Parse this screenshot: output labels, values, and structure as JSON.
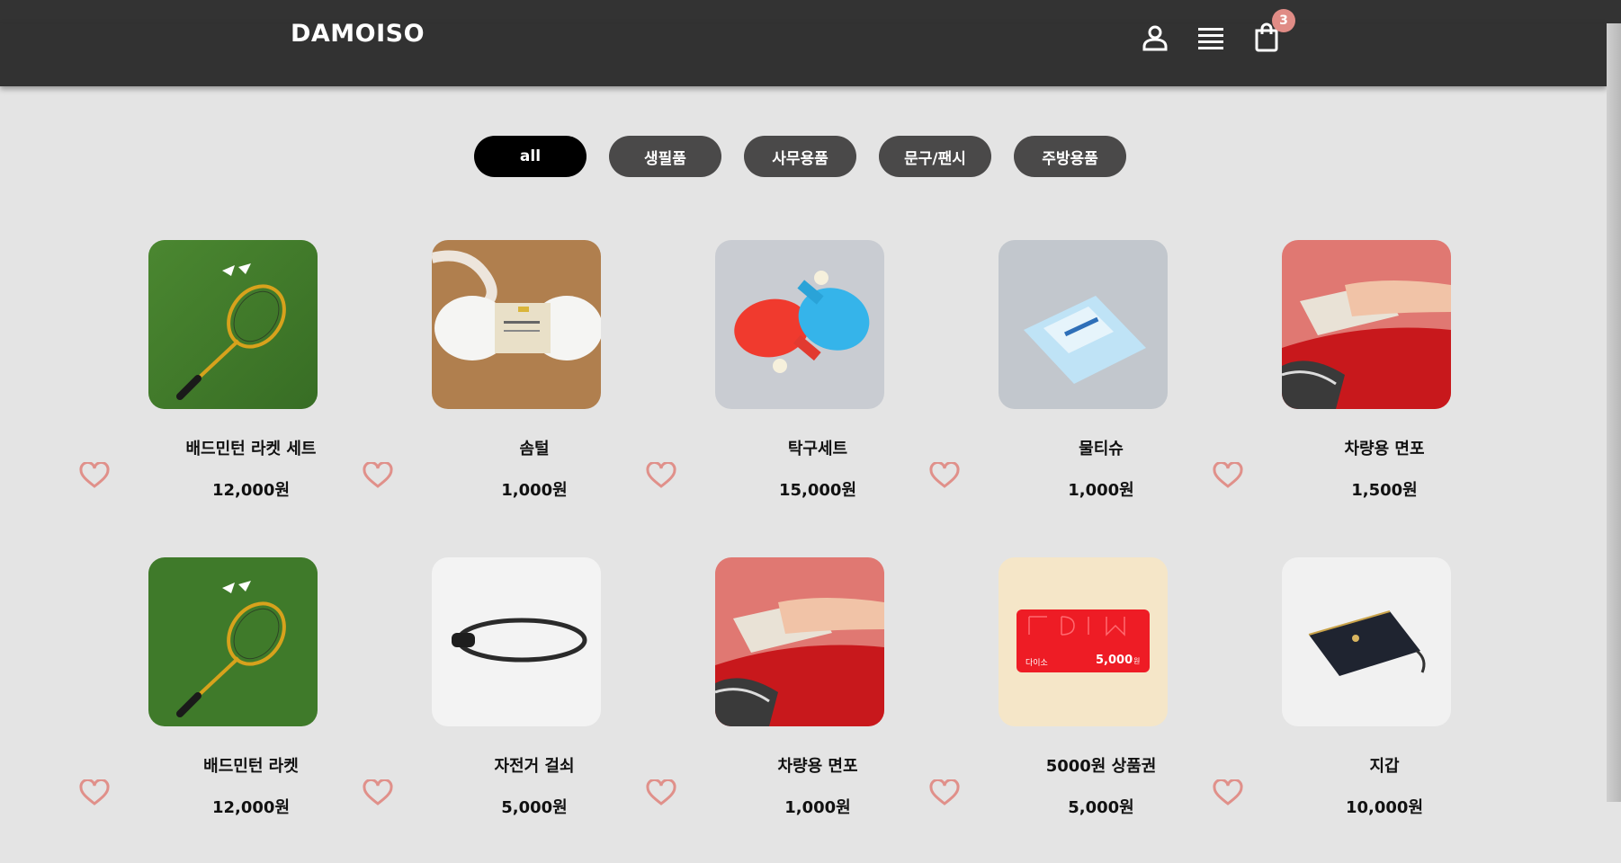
{
  "header": {
    "logo": "DAMOISO",
    "cart_count": "3",
    "icons": [
      "user-icon",
      "menu-icon",
      "shopping-bag-icon"
    ]
  },
  "filters": [
    {
      "label": "all",
      "active": true
    },
    {
      "label": "생필품",
      "active": false
    },
    {
      "label": "사무용품",
      "active": false
    },
    {
      "label": "문구/팬시",
      "active": false
    },
    {
      "label": "주방용품",
      "active": false
    }
  ],
  "products": [
    {
      "name": "배드민턴 라켓 세트",
      "price": "12,000원",
      "image": "badminton-racket-image"
    },
    {
      "name": "솜털",
      "price": "1,000원",
      "image": "cotton-fluff-image"
    },
    {
      "name": "탁구세트",
      "price": "15,000원",
      "image": "ping-pong-set-image"
    },
    {
      "name": "물티슈",
      "price": "1,000원",
      "image": "wet-tissue-image"
    },
    {
      "name": "차량용 면포",
      "price": "1,500원",
      "image": "car-cloth-image"
    },
    {
      "name": "배드민턴 라켓",
      "price": "12,000원",
      "image": "badminton-racket-image"
    },
    {
      "name": "자전거 걸쇠",
      "price": "5,000원",
      "image": "bicycle-lock-image"
    },
    {
      "name": "차량용 면포",
      "price": "1,000원",
      "image": "car-cloth-image"
    },
    {
      "name": "5000원 상품권",
      "price": "5,000원",
      "image": "gift-card-image"
    },
    {
      "name": "지갑",
      "price": "10,000원",
      "image": "wallet-image"
    }
  ],
  "gift_card": {
    "brand": "다이소",
    "amount": "5,000",
    "unit": "원"
  },
  "colors": {
    "header": "#323232",
    "background": "#e4e4e4",
    "badge": "#e08c86",
    "heart": "#e0908a",
    "filter": "#4a4949",
    "filter_active": "#000000"
  }
}
